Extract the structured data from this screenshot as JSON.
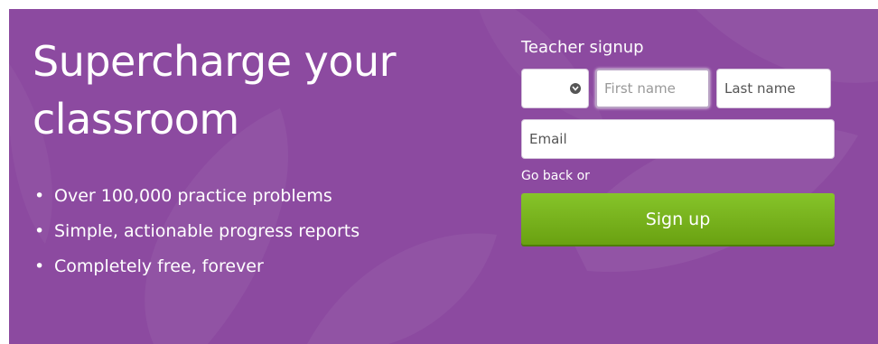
{
  "hero": {
    "background_color": "#8c4aa0",
    "headline": "Supercharge your classroom",
    "features": [
      "Over 100,000 practice problems",
      "Simple, actionable progress reports",
      "Completely free, forever"
    ]
  },
  "signup": {
    "title": "Teacher signup",
    "title_select": {
      "value": "",
      "icon": "chevron-down-icon"
    },
    "first_name_placeholder": "First name",
    "last_name_placeholder": "Last name",
    "email_placeholder": "Email",
    "go_back_text": "Go back or",
    "button_label": "Sign up",
    "button_color": "#78b41c"
  }
}
